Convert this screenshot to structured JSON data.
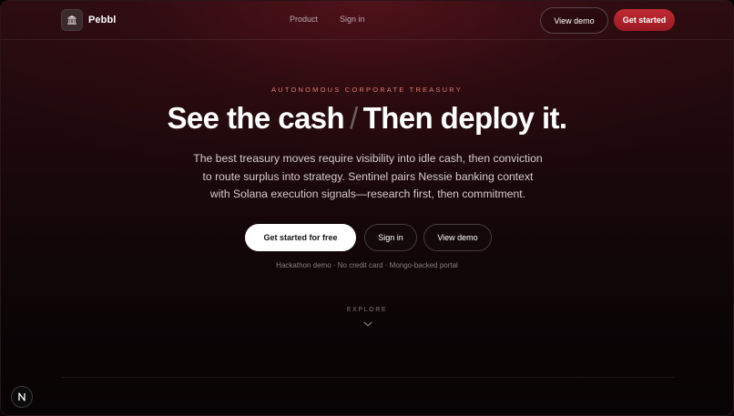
{
  "nav": {
    "brand": "Pebbl",
    "logo_icon": "bank-icon",
    "links": [
      "Product",
      "Sign in"
    ],
    "view_demo": "View demo",
    "get_started": "Get started"
  },
  "hero": {
    "eyebrow": "AUTONOMOUS CORPORATE TREASURY",
    "headline_part1": "See the cash",
    "headline_sep": "/",
    "headline_part2": "Then deploy it.",
    "subcopy_line1": "The best treasury moves require visibility into idle cash, then conviction",
    "subcopy_line2": "to route surplus into strategy. Sentinel pairs Nessie banking context",
    "subcopy_line3": "with Solana execution signals—research first, then commitment.",
    "cta_primary": "Get started for free",
    "cta_signin": "Sign in",
    "cta_demo": "View demo",
    "fineprint": "Hackathon demo · No credit card · Mongo-backed portal",
    "explore": "EXPLORE"
  },
  "colors": {
    "accent_red": "#c02a32",
    "eyebrow": "#e07a72",
    "background": "#0a0405"
  }
}
